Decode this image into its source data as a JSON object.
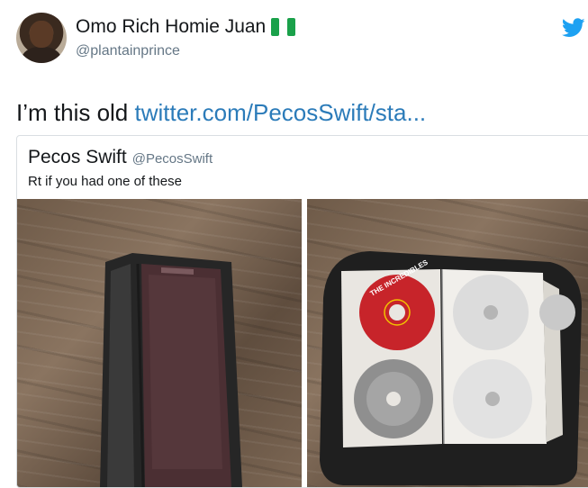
{
  "header": {
    "display_name": "Omo Rich Homie Juan",
    "handle": "@plantainprince",
    "flag_icon": "nigeria-flag-icon",
    "brand_icon": "twitter-bird-icon",
    "brand_color": "#1da1f2"
  },
  "tweet": {
    "text": "I’m this old ",
    "link_text": "twitter.com/PecosSwift/sta...",
    "link_color": "#2b7bb9"
  },
  "quoted_tweet": {
    "display_name": "Pecos Swift",
    "handle": "@PecosSwift",
    "text": "Rt if you had one of these",
    "images": [
      {
        "name": "closed-cd-case-photo"
      },
      {
        "name": "open-cd-case-photo",
        "disc_label": "THE INCREDIBLES"
      }
    ]
  }
}
